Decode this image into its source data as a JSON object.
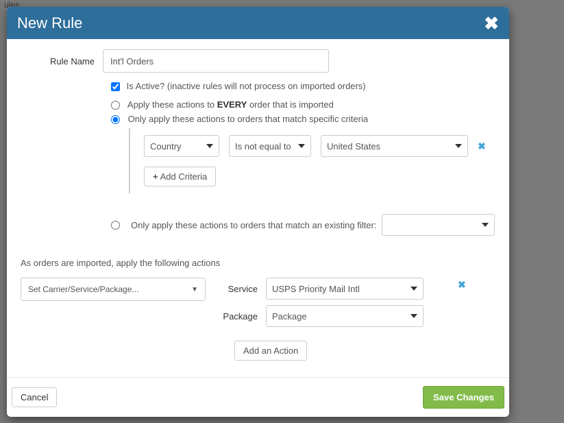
{
  "modal": {
    "title": "New Rule",
    "rule_name_label": "Rule Name",
    "rule_name_value": "Int'l Orders",
    "is_active_label": "Is Active? (inactive rules will not process on imported orders)",
    "radio_every_prefix": "Apply these actions to ",
    "radio_every_bold": "EVERY",
    "radio_every_suffix": " order that is imported",
    "radio_criteria": "Only apply these actions to orders that match specific criteria",
    "criteria": {
      "field": "Country",
      "operator": "Is not equal to",
      "value": "United States",
      "add_button": "Add Criteria"
    },
    "radio_filter": "Only apply these actions to orders that match an existing filter:",
    "filter_value": "",
    "actions_header": "As orders are imported, apply the following actions",
    "action_selector": "Set Carrier/Service/Package...",
    "service_label": "Service",
    "service_value": "USPS Priority Mail Intl",
    "package_label": "Package",
    "package_value": "Package",
    "add_action_button": "Add an Action",
    "cancel_button": "Cancel",
    "save_button": "Save Changes"
  }
}
